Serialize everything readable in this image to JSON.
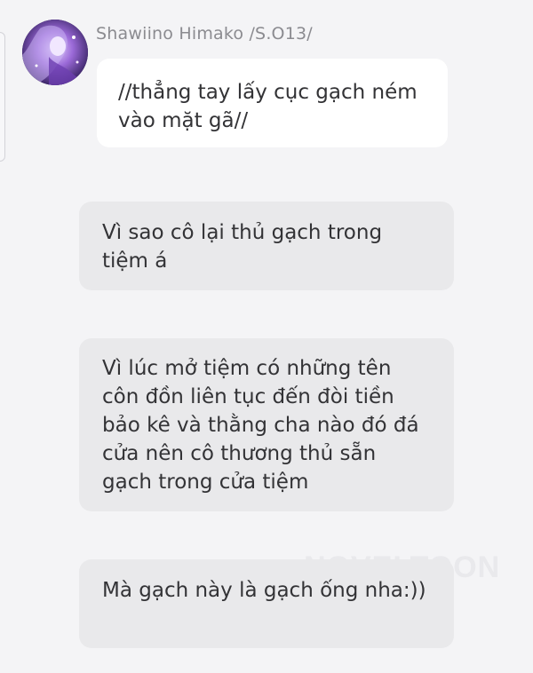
{
  "chat": {
    "sender": {
      "name": "Shawiino Himako /S.O13/",
      "avatar_icon": "avatar-portrait"
    },
    "messages": [
      {
        "side": "sent",
        "text": "//thẳng tay lấy cục gạch ném vào mặt gã//"
      },
      {
        "side": "received",
        "text": "Vì sao cô lại thủ gạch trong tiệm á"
      },
      {
        "side": "received",
        "text": "Vì lúc mở tiệm có những tên côn đồn liên tục đến đòi tiền bảo kê và thằng cha nào đó đá cửa nên cô thương thủ sẵn gạch trong cửa tiệm"
      },
      {
        "side": "received",
        "text": "Mà gạch này là gạch ống nha:))"
      }
    ]
  },
  "watermark": "NOVELTOON",
  "colors": {
    "background": "#f4f4f6",
    "sent_bubble": "#ffffff",
    "received_bubble": "#e9e9eb",
    "text": "#333336",
    "name_text": "#8b8b90"
  }
}
